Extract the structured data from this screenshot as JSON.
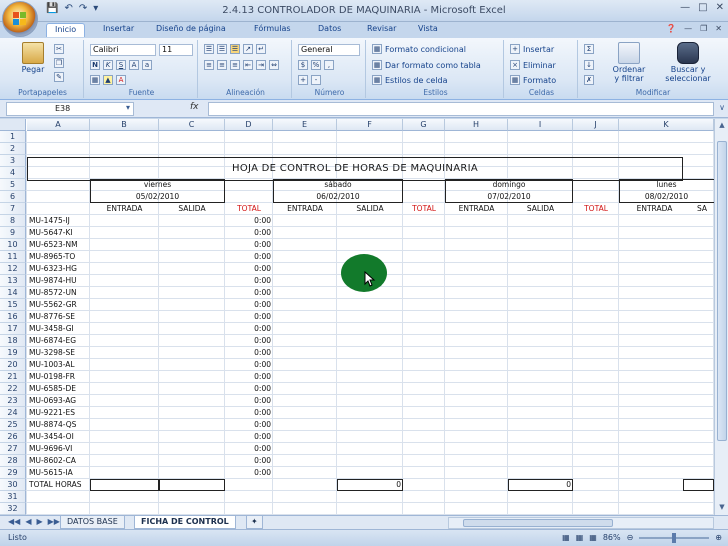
{
  "window": {
    "title": "2.4.13 CONTROLADOR DE MAQUINARIA - Microsoft Excel"
  },
  "tabs": [
    {
      "label": "Inicio",
      "active": true
    },
    {
      "label": "Insertar"
    },
    {
      "label": "Diseño de página"
    },
    {
      "label": "Fórmulas"
    },
    {
      "label": "Datos"
    },
    {
      "label": "Revisar"
    },
    {
      "label": "Vista"
    }
  ],
  "ribbon": {
    "clipboard": {
      "paste": "Pegar",
      "group": "Portapapeles"
    },
    "font": {
      "name": "Calibri",
      "size": "11",
      "group": "Fuente"
    },
    "alignment": {
      "group": "Alineación"
    },
    "number": {
      "format": "General",
      "group": "Número"
    },
    "styles": {
      "conditional": "Formato condicional",
      "as_table": "Dar formato como tabla",
      "cell_styles": "Estilos de celda",
      "group": "Estilos"
    },
    "cells": {
      "insert": "Insertar",
      "delete": "Eliminar",
      "format": "Formato",
      "group": "Celdas"
    },
    "editing": {
      "sort_1": "Ordenar",
      "sort_2": "y filtrar",
      "find_1": "Buscar y",
      "find_2": "seleccionar",
      "group": "Modificar"
    }
  },
  "formula_bar": {
    "name_box": "E38",
    "fx": "fx",
    "formula": ""
  },
  "columns": [
    "A",
    "B",
    "C",
    "D",
    "E",
    "F",
    "G",
    "H",
    "I",
    "J",
    "K"
  ],
  "rows": [
    "1",
    "2",
    "3",
    "4",
    "5",
    "6",
    "7",
    "8",
    "9",
    "10",
    "11",
    "12",
    "13",
    "14",
    "15",
    "16",
    "17",
    "18",
    "19",
    "20",
    "21",
    "22",
    "23",
    "24",
    "25",
    "26",
    "27",
    "28",
    "29",
    "30",
    "31",
    "32"
  ],
  "sheet": {
    "title": "HOJA DE CONTROL DE HORAS DE MAQUINARIA",
    "days": [
      {
        "name": "viernes",
        "date": "05/02/2010"
      },
      {
        "name": "sábado",
        "date": "06/02/2010"
      },
      {
        "name": "domingo",
        "date": "07/02/2010"
      },
      {
        "name": "lunes",
        "date": "08/02/2010"
      }
    ],
    "sub_headers": {
      "entrada": "ENTRADA",
      "salida": "SALIDA",
      "total": "TOTAL",
      "salida_cut": "SA"
    },
    "machines": [
      "MU-1475-IJ",
      "MU-5647-KI",
      "MU-6523-NM",
      "MU-8965-TO",
      "MU-6323-HG",
      "MU-9874-HU",
      "MU-8572-UN",
      "MU-5562-GR",
      "MU-8776-SE",
      "MU-3458-GI",
      "MU-6874-EG",
      "MU-3298-SE",
      "MU-1003-AL",
      "MU-0198-FR",
      "MU-6585-DE",
      "MU-0693-AG",
      "MU-9221-ES",
      "MU-8874-QS",
      "MU-3454-OI",
      "MU-9696-VI",
      "MU-8602-CA",
      "MU-5615-IA"
    ],
    "total_value": "0:00",
    "total_row_label": "TOTAL HORAS",
    "total_sabado": "0",
    "total_domingo": "0"
  },
  "sheet_tabs": [
    {
      "label": "DATOS BASE"
    },
    {
      "label": "FICHA DE CONTROL",
      "active": true
    }
  ],
  "status": {
    "ready": "Listo",
    "zoom": "86%"
  }
}
